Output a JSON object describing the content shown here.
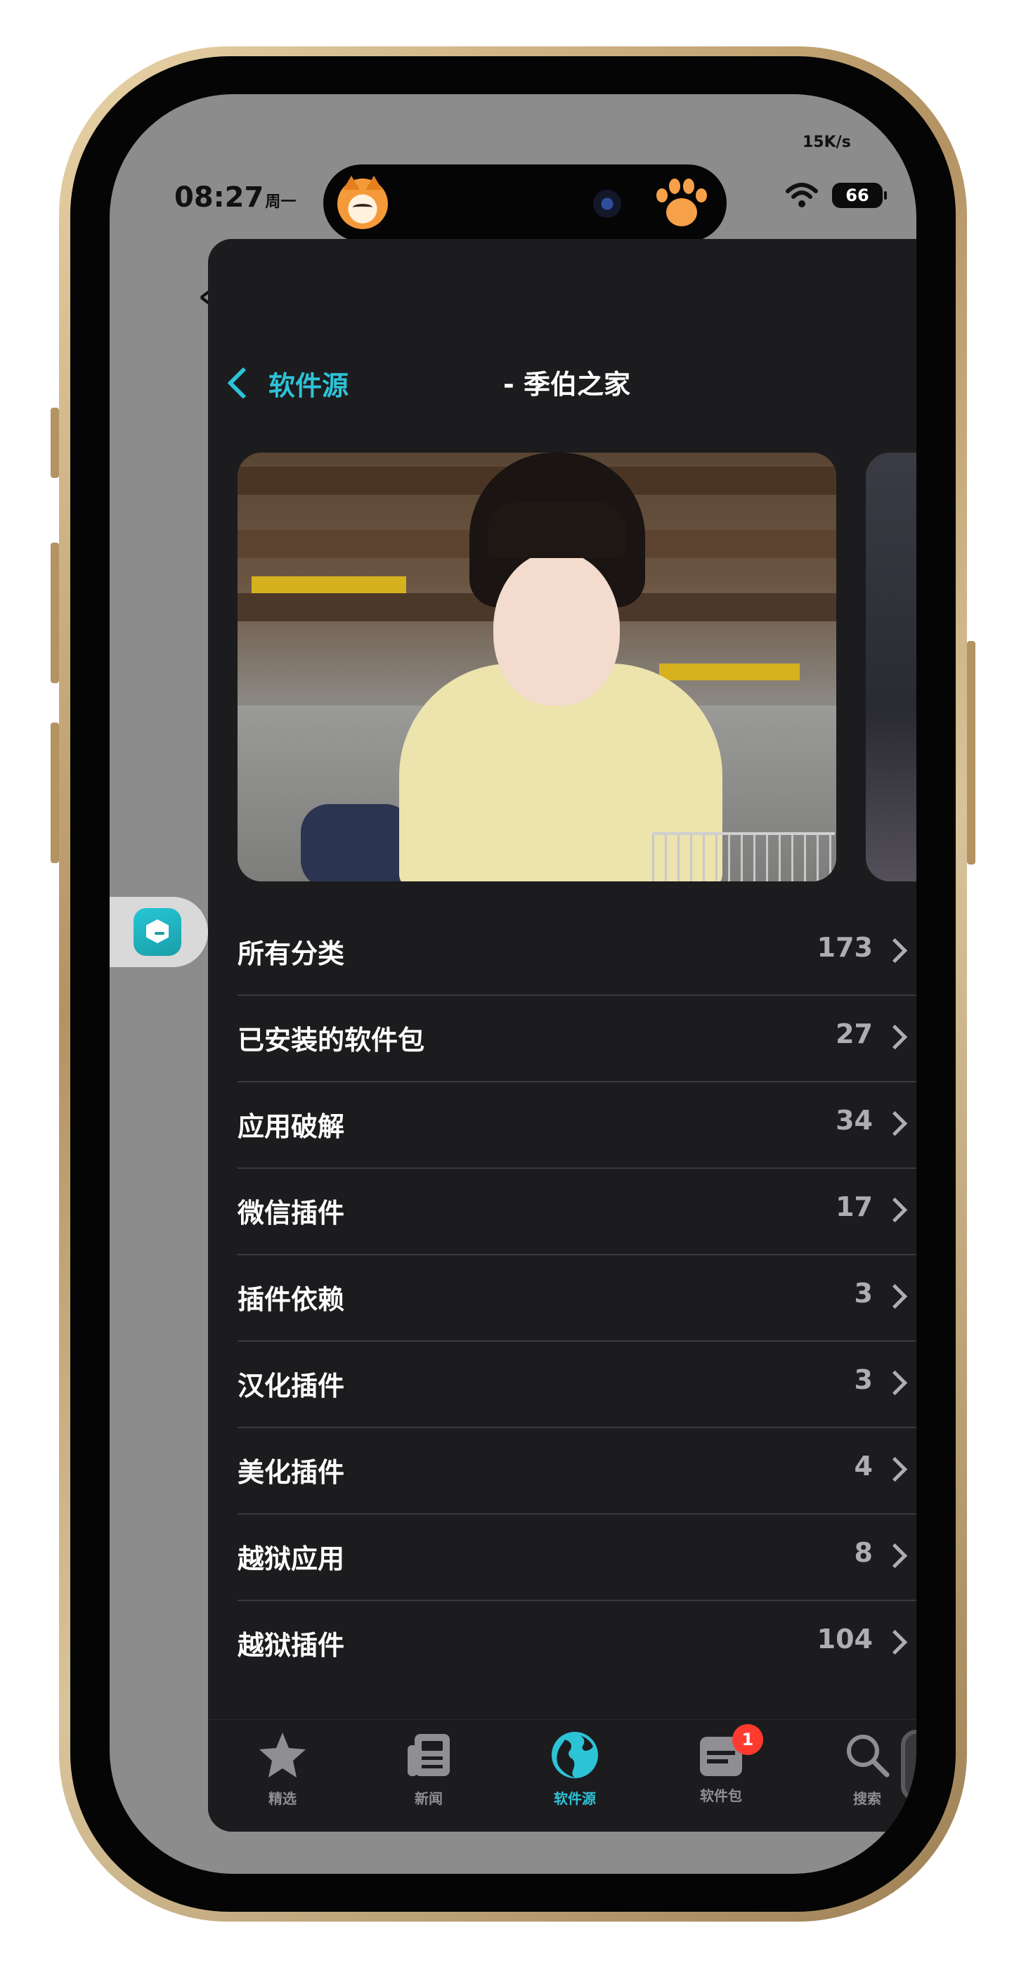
{
  "status_bar": {
    "time": "08:27",
    "weekday": "周一",
    "net_speed": "15K/s",
    "battery": "66"
  },
  "nav": {
    "back_label": "软件源",
    "title": "- 季伯之家"
  },
  "categories": [
    {
      "label": "所有分类",
      "count": "173"
    },
    {
      "label": "已安装的软件包",
      "count": "27"
    },
    {
      "label": "应用破解",
      "count": "34"
    },
    {
      "label": "微信插件",
      "count": "17"
    },
    {
      "label": "插件依赖",
      "count": "3"
    },
    {
      "label": "汉化插件",
      "count": "3"
    },
    {
      "label": "美化插件",
      "count": "4"
    },
    {
      "label": "越狱应用",
      "count": "8"
    },
    {
      "label": "越狱插件",
      "count": "104"
    }
  ],
  "tab_bar": {
    "tabs": [
      {
        "label": "精选",
        "icon": "star-icon"
      },
      {
        "label": "新闻",
        "icon": "newspaper-icon"
      },
      {
        "label": "软件源",
        "icon": "globe-icon",
        "active": true
      },
      {
        "label": "软件包",
        "icon": "package-icon",
        "badge": "1"
      },
      {
        "label": "搜索",
        "icon": "search-icon"
      }
    ]
  },
  "colors": {
    "accent": "#2dc3d7",
    "background": "#1c1c1e",
    "badge": "#ff3b30"
  }
}
